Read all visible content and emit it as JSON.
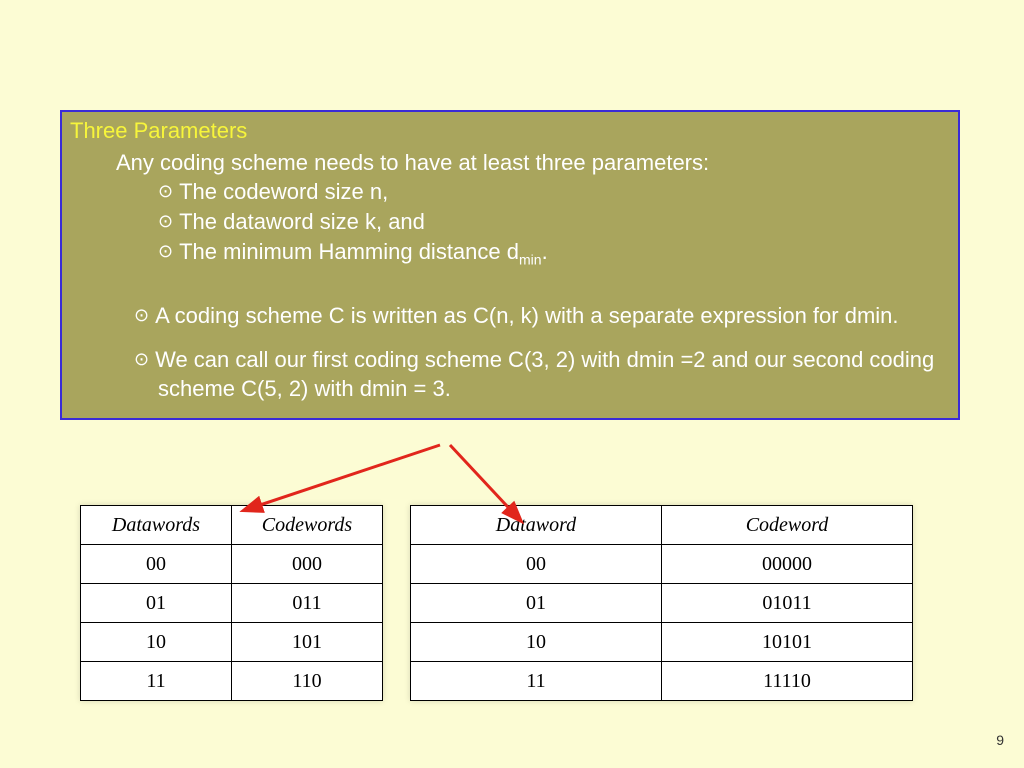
{
  "box": {
    "heading": "Three Parameters",
    "intro": "Any coding scheme needs to have at least three parameters:",
    "param1": "The codeword size n,",
    "param2": "The dataword size k, and",
    "param3_a": "The  minimum Hamming distance d",
    "param3_sub": "min",
    "param3_b": ".",
    "scheme_note": "A coding scheme C is written as C(n, k) with a separate expression for dmin.",
    "example_note": "We can call our first coding scheme C(3, 2) with dmin =2 and our second coding scheme C(5, 2) with dmin = 3."
  },
  "table1": {
    "head_dw": "Datawords",
    "head_cw": "Codewords",
    "rows": [
      {
        "dw": "00",
        "cw": "000"
      },
      {
        "dw": "01",
        "cw": "011"
      },
      {
        "dw": "10",
        "cw": "101"
      },
      {
        "dw": "11",
        "cw": "110"
      }
    ]
  },
  "table2": {
    "head_dw": "Dataword",
    "head_cw": "Codeword",
    "rows": [
      {
        "dw": "00",
        "cw": "00000"
      },
      {
        "dw": "01",
        "cw": "01011"
      },
      {
        "dw": "10",
        "cw": "10101"
      },
      {
        "dw": "11",
        "cw": "11110"
      }
    ]
  },
  "page_number": "9",
  "chart_data": {
    "type": "table",
    "tables": [
      {
        "title": "C(3,2) dmin=2",
        "columns": [
          "Datawords",
          "Codewords"
        ],
        "rows": [
          [
            "00",
            "000"
          ],
          [
            "01",
            "011"
          ],
          [
            "10",
            "101"
          ],
          [
            "11",
            "110"
          ]
        ]
      },
      {
        "title": "C(5,2) dmin=3",
        "columns": [
          "Dataword",
          "Codeword"
        ],
        "rows": [
          [
            "00",
            "00000"
          ],
          [
            "01",
            "01011"
          ],
          [
            "10",
            "10101"
          ],
          [
            "11",
            "11110"
          ]
        ]
      }
    ]
  }
}
